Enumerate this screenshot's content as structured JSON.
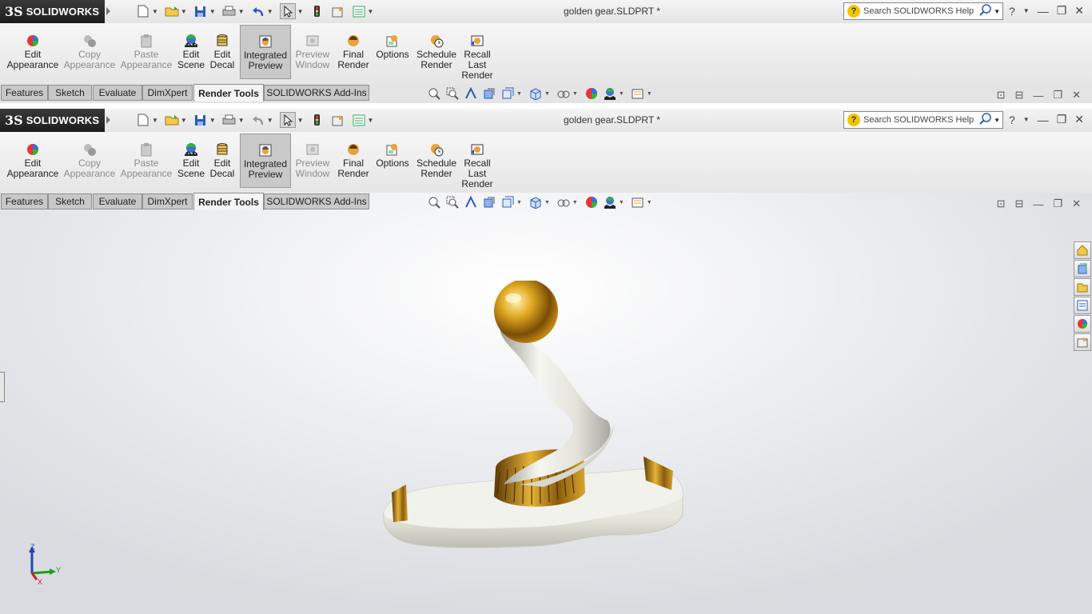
{
  "app": {
    "brand_ds": "3S",
    "brand_name": "SOLIDWORKS"
  },
  "document": {
    "title": "golden gear.SLDPRT *"
  },
  "search": {
    "placeholder": "Search SOLIDWORKS Help"
  },
  "ribbon": {
    "edit_appearance": [
      "Edit",
      "Appearance"
    ],
    "copy_appearance": [
      "Copy",
      "Appearance"
    ],
    "paste_appearance": [
      "Paste",
      "Appearance"
    ],
    "edit_scene": [
      "Edit",
      "Scene"
    ],
    "edit_decal": [
      "Edit",
      "Decal"
    ],
    "integrated_preview": [
      "Integrated",
      "Preview"
    ],
    "preview_window": [
      "Preview",
      "Window"
    ],
    "final_render": [
      "Final",
      "Render"
    ],
    "options": [
      "Options"
    ],
    "schedule_render": [
      "Schedule",
      "Render"
    ],
    "recall_last_render": [
      "Recall",
      "Last",
      "Render"
    ]
  },
  "tabs": {
    "features": "Features",
    "sketch": "Sketch",
    "evaluate": "Evaluate",
    "dimxpert": "DimXpert",
    "render_tools": "Render Tools",
    "addins": "SOLIDWORKS Add-Ins"
  },
  "triad": {
    "z": "Z",
    "y": "Y",
    "x": "X"
  },
  "colors": {
    "accent_gold": "#d4a017",
    "model_white": "#ecece4"
  }
}
